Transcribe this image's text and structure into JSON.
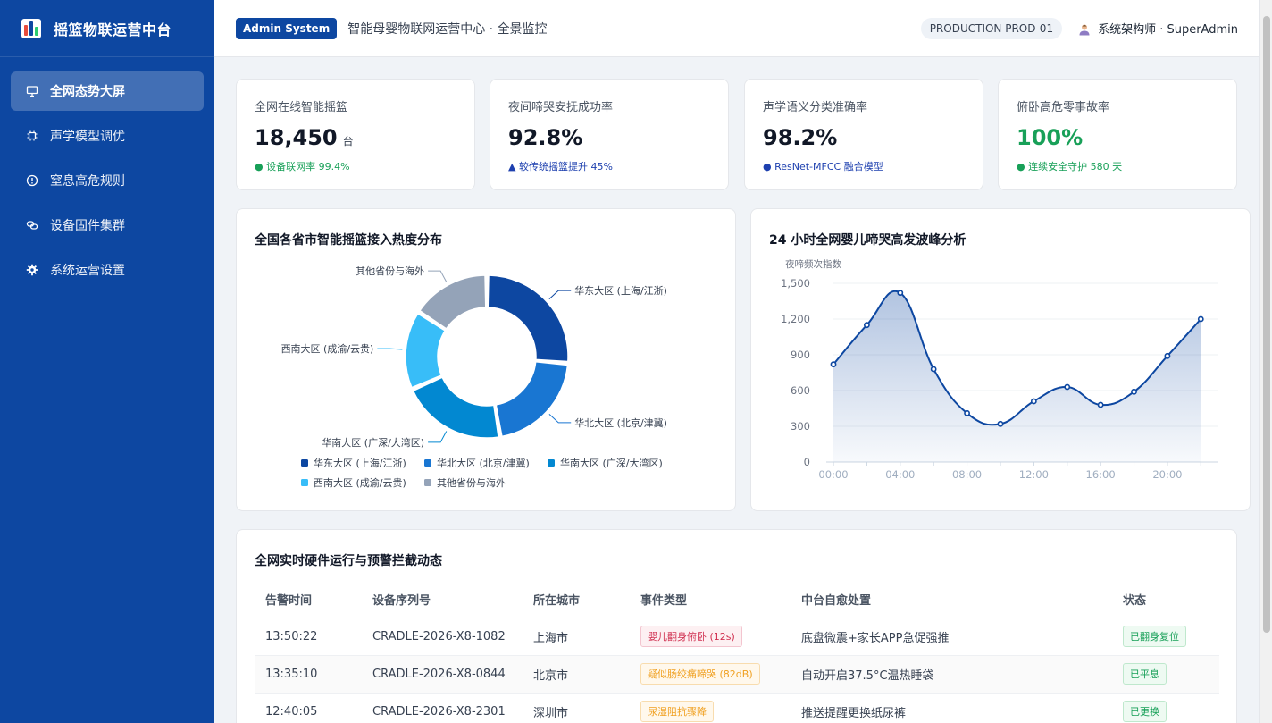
{
  "app": {
    "title": "摇篮物联运营中台"
  },
  "sidebar": {
    "items": [
      {
        "label": "全网态势大屏",
        "icon": "monitor-icon",
        "active": true
      },
      {
        "label": "声学模型调优",
        "icon": "chip-icon",
        "active": false
      },
      {
        "label": "窒息高危规则",
        "icon": "alert-circle-icon",
        "active": false
      },
      {
        "label": "设备固件集群",
        "icon": "link-icon",
        "active": false
      },
      {
        "label": "系统运营设置",
        "icon": "gear-icon",
        "active": false
      }
    ]
  },
  "header": {
    "badge": "Admin System",
    "subtitle": "智能母婴物联网运营中心 · 全景监控",
    "env": "PRODUCTION PROD-01",
    "user": "系统架构师 · SuperAdmin"
  },
  "kpis": [
    {
      "label": "全网在线智能摇篮",
      "value": "18,450",
      "unit": "台",
      "note": "● 设备联网率 99.4%",
      "note_color": "#18a058",
      "value_color": "#111827"
    },
    {
      "label": "夜间啼哭安抚成功率",
      "value": "92.8%",
      "unit": "",
      "note": "▲ 较传统摇篮提升 45%",
      "note_color": "#1e40af",
      "value_color": "#111827"
    },
    {
      "label": "声学语义分类准确率",
      "value": "98.2%",
      "unit": "",
      "note": "● ResNet-MFCC 融合模型",
      "note_color": "#1e40af",
      "value_color": "#111827"
    },
    {
      "label": "俯卧高危零事故率",
      "value": "100%",
      "unit": "",
      "note": "● 连续安全守护 580 天",
      "note_color": "#18a058",
      "value_color": "#18a058"
    }
  ],
  "chart_data": [
    {
      "type": "pie",
      "title": "全国各省市智能摇篮接入热度分布",
      "categories": [
        "华东大区 (上海/江浙)",
        "华北大区 (北京/津冀)",
        "华南大区 (广深/大湾区)",
        "西南大区 (成渝/云贵)",
        "其他省份与海外"
      ],
      "values": [
        25,
        20,
        20,
        15,
        15
      ],
      "colors": [
        "#0d47a1",
        "#1976d2",
        "#0288d1",
        "#38bdf8",
        "#94a3b8"
      ],
      "legend": "bottom"
    },
    {
      "type": "area",
      "title": "24 小时全网婴儿啼哭高发波峰分析",
      "ylabel": "夜啼频次指数",
      "x": [
        "00:00",
        "02:00",
        "04:00",
        "06:00",
        "08:00",
        "10:00",
        "12:00",
        "14:00",
        "16:00",
        "18:00",
        "20:00",
        "22:00"
      ],
      "x_ticks": [
        "00:00",
        "04:00",
        "08:00",
        "12:00",
        "16:00",
        "20:00"
      ],
      "values": [
        820,
        1150,
        1420,
        780,
        410,
        320,
        510,
        630,
        480,
        590,
        890,
        1200
      ],
      "ylim": [
        0,
        1500
      ],
      "y_ticks": [
        "0",
        "300",
        "600",
        "900",
        "1,200",
        "1,500"
      ],
      "color": "#0d47a1",
      "grid": true
    }
  ],
  "events": {
    "title": "全网实时硬件运行与预警拦截动态",
    "columns": [
      "告警时间",
      "设备序列号",
      "所在城市",
      "事件类型",
      "中台自愈处置",
      "状态"
    ],
    "rows": [
      {
        "time": "13:50:22",
        "serial": "CRADLE-2026-X8-1082",
        "city": "上海市",
        "event": "婴儿翻身俯卧 (12s)",
        "event_level": "red",
        "action": "底盘微震+家长APP急促强推",
        "status": "已翻身复位"
      },
      {
        "time": "13:35:10",
        "serial": "CRADLE-2026-X8-0844",
        "city": "北京市",
        "event": "疑似肠绞痛啼哭 (82dB)",
        "event_level": "orange",
        "action": "自动开启37.5°C温热睡袋",
        "status": "已平息"
      },
      {
        "time": "12:40:05",
        "serial": "CRADLE-2026-X8-2301",
        "city": "深圳市",
        "event": "尿湿阻抗骤降",
        "event_level": "orange",
        "action": "推送提醒更换纸尿裤",
        "status": "已更换"
      }
    ]
  }
}
